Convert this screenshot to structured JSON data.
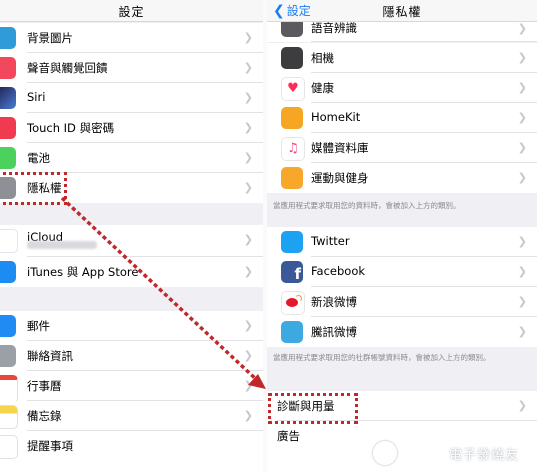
{
  "left": {
    "title": "設定",
    "items": [
      {
        "label": "背景圖片",
        "icon": "wallpaper-icon",
        "color": "#2f9bd8"
      },
      {
        "label": "聲音與觸覺回饋",
        "icon": "sound-icon",
        "color": "#f2475d"
      },
      {
        "label": "Siri",
        "icon": "siri-icon",
        "color": "#1d1d44"
      },
      {
        "label": "Touch ID 與密碼",
        "icon": "fingerprint-icon",
        "color": "#f03a4f"
      },
      {
        "label": "電池",
        "icon": "battery-icon",
        "color": "#4cd15d"
      },
      {
        "label": "隱私權",
        "icon": "hand-icon",
        "color": "#8f8f96"
      },
      {
        "label": "iCloud",
        "icon": "cloud-icon",
        "color": "#ffffff"
      },
      {
        "label": "iTunes 與 App Store",
        "icon": "app-store-icon",
        "color": "#1d8cf2"
      },
      {
        "label": "郵件",
        "icon": "mail-icon",
        "color": "#1f8bf3"
      },
      {
        "label": "聯絡資訊",
        "icon": "contacts-icon",
        "color": "#9aa0a6"
      },
      {
        "label": "行事曆",
        "icon": "calendar-icon",
        "color": "#ffffff"
      },
      {
        "label": "備忘錄",
        "icon": "notes-icon",
        "color": "#f7d54b"
      },
      {
        "label": "提醒事項",
        "icon": "reminders-icon",
        "color": "#ffffff"
      }
    ]
  },
  "right": {
    "title": "隱私權",
    "back_label": "設定",
    "items": [
      {
        "label": "語音辨識",
        "icon": "speech-icon",
        "color": "#5a5a5f"
      },
      {
        "label": "相機",
        "icon": "camera-icon",
        "color": "#3d3d40"
      },
      {
        "label": "健康",
        "icon": "health-icon",
        "color": "#ffffff"
      },
      {
        "label": "HomeKit",
        "icon": "homekit-icon",
        "color": "#f6a623"
      },
      {
        "label": "媒體資料庫",
        "icon": "music-icon",
        "color": "#ffffff"
      },
      {
        "label": "運動與健身",
        "icon": "motion-icon",
        "color": "#f7a82a"
      },
      {
        "label": "Twitter",
        "icon": "twitter-icon",
        "color": "#1da1f2"
      },
      {
        "label": "Facebook",
        "icon": "facebook-icon",
        "color": "#3b5998"
      },
      {
        "label": "新浪微博",
        "icon": "weibo-icon",
        "color": "#ffffff"
      },
      {
        "label": "騰訊微博",
        "icon": "tencent-weibo-icon",
        "color": "#3ea9e0"
      },
      {
        "label": "診斷與用量",
        "icon": "",
        "color": ""
      },
      {
        "label": "廣告",
        "icon": "",
        "color": ""
      }
    ],
    "footer1": "當應用程式要求取用您的資料時，會被加入上方的類別。",
    "footer2": "當應用程式要求取用您的社群帳號資料時，會被加入上方的類別。"
  },
  "highlight_color": "#c0282a",
  "accent": "#1a7cf3",
  "watermark": "電子發燒友"
}
